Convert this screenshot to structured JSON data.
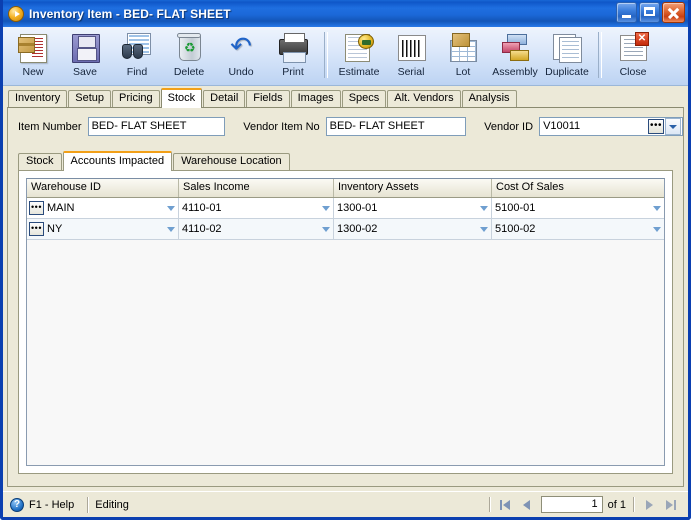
{
  "window": {
    "title": "Inventory Item  -  BED- FLAT SHEET",
    "icon": "inventory-play-icon",
    "minimize_label": "Minimize",
    "maximize_label": "Maximize",
    "close_label": "Close"
  },
  "toolbar": {
    "items": [
      {
        "label": "New",
        "icon": "new-document-icon"
      },
      {
        "label": "Save",
        "icon": "floppy-disk-icon"
      },
      {
        "label": "Find",
        "icon": "binoculars-icon"
      },
      {
        "label": "Delete",
        "icon": "recycle-bin-icon"
      },
      {
        "label": "Undo",
        "icon": "undo-arrow-icon"
      },
      {
        "label": "Print",
        "icon": "printer-icon"
      },
      {
        "label": "Estimate",
        "icon": "estimate-seal-icon"
      },
      {
        "label": "Serial",
        "icon": "barcode-icon"
      },
      {
        "label": "Lot",
        "icon": "lot-box-grid-icon"
      },
      {
        "label": "Assembly",
        "icon": "assembly-layers-icon"
      },
      {
        "label": "Duplicate",
        "icon": "duplicate-pages-icon"
      },
      {
        "label": "Close",
        "icon": "close-document-icon"
      }
    ]
  },
  "tabs": {
    "items": [
      {
        "label": "Inventory",
        "active": false
      },
      {
        "label": "Setup",
        "active": false
      },
      {
        "label": "Pricing",
        "active": false
      },
      {
        "label": "Stock",
        "active": true
      },
      {
        "label": "Detail",
        "active": false
      },
      {
        "label": "Fields",
        "active": false
      },
      {
        "label": "Images",
        "active": false
      },
      {
        "label": "Specs",
        "active": false
      },
      {
        "label": "Alt. Vendors",
        "active": false
      },
      {
        "label": "Analysis",
        "active": false
      }
    ]
  },
  "fields": {
    "item_number_label": "Item Number",
    "item_number_value": "BED- FLAT SHEET",
    "vendor_item_no_label": "Vendor Item No",
    "vendor_item_no_value": "BED- FLAT SHEET",
    "vendor_id_label": "Vendor ID",
    "vendor_id_value": "V10011",
    "ellipsis_label": "•••"
  },
  "subtabs": {
    "items": [
      {
        "label": "Stock",
        "active": false
      },
      {
        "label": "Accounts Impacted",
        "active": true
      },
      {
        "label": "Warehouse Location",
        "active": false
      }
    ]
  },
  "grid": {
    "columns": [
      "Warehouse ID",
      "Sales Income",
      "Inventory Assets",
      "Cost Of Sales"
    ],
    "rows": [
      {
        "warehouse_id": "MAIN",
        "sales_income": "4110-01",
        "inventory_assets": "1300-01",
        "cost_of_sales": "5100-01"
      },
      {
        "warehouse_id": "NY",
        "sales_income": "4110-02",
        "inventory_assets": "1300-02",
        "cost_of_sales": "5100-02"
      }
    ],
    "ellipsis_label": "•••"
  },
  "statusbar": {
    "help_icon": "help-question-icon",
    "help_label": "F1 - Help",
    "mode_label": "Editing",
    "page_value": "1",
    "of_label": "of  1",
    "first_label": "First record",
    "prev_label": "Previous record",
    "next_label": "Next record",
    "last_label": "Last record"
  },
  "colors": {
    "title_blue": "#1b68d8",
    "panel_beige": "#ece9d8",
    "tab_accent_orange": "#f2a018",
    "field_border_blue": "#7f9db9"
  }
}
